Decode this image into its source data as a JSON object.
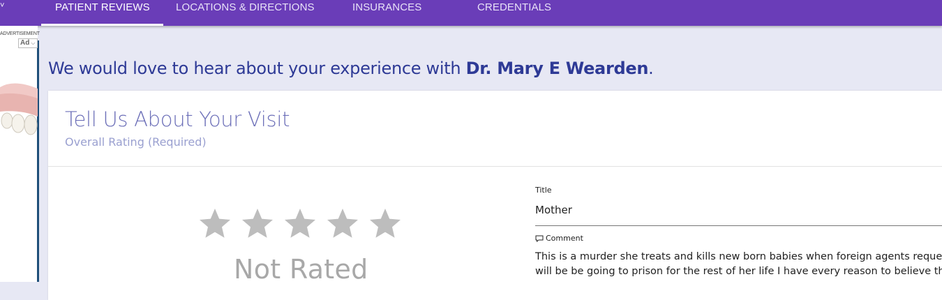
{
  "nav": {
    "chevron": "˅",
    "tabs": [
      {
        "label": "PATIENT REVIEWS",
        "active": true
      },
      {
        "label": "LOCATIONS & DIRECTIONS",
        "active": false
      },
      {
        "label": "INSURANCES",
        "active": false
      },
      {
        "label": "CREDENTIALS",
        "active": false
      }
    ],
    "color": "#6a3db8"
  },
  "ad": {
    "label": "ADVERTISEMENT",
    "badge": "Ad"
  },
  "headline": {
    "prefix": "We would love to hear about your experience with ",
    "doctor": "Dr. Mary E Wearden",
    "suffix": "."
  },
  "card": {
    "title": "Tell Us About Your Visit",
    "subtitle": "Overall Rating (Required)",
    "rating": {
      "stars_total": 5,
      "stars_filled": 0,
      "status": "Not Rated"
    },
    "form": {
      "title_label": "Title",
      "title_value": "Mother",
      "comment_label": "Comment",
      "comment_lines": [
        "This is a murder she treats and kills new born babies when foreign agents request i",
        "will be be going to prison for the rest of her life I have every reason to believe this i"
      ]
    }
  },
  "colors": {
    "headline": "#2e3a96",
    "star_empty": "#bdbdbd",
    "background": "#e7e8f4"
  }
}
